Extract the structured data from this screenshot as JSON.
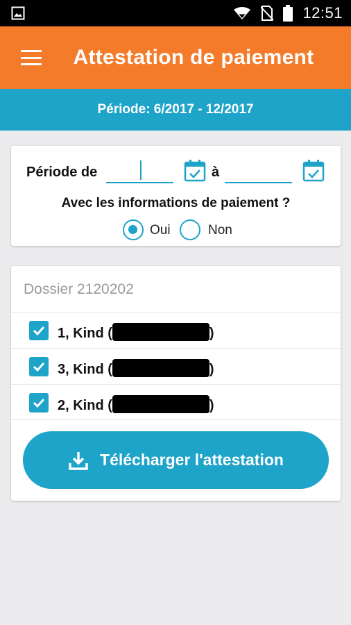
{
  "status_bar": {
    "time": "12:51",
    "icons": [
      "image-icon",
      "wifi-icon",
      "no-sim-icon",
      "battery-icon"
    ]
  },
  "app_bar": {
    "title": "Attestation de paiement",
    "menu_icon": "hamburger-menu-icon",
    "color": "#f47b2a"
  },
  "period_banner": {
    "text": "Période: 6/2017 - 12/2017",
    "color": "#1ea3c9"
  },
  "filter": {
    "period_from_label": "Période de",
    "period_from_value": "",
    "period_to_label": "à",
    "period_to_value": "",
    "calendar_icon": "calendar-check-icon",
    "question": "Avec les informations de paiement ?",
    "options": [
      {
        "label": "Oui",
        "selected": true
      },
      {
        "label": "Non",
        "selected": false
      }
    ]
  },
  "dossier": {
    "title": "Dossier 2120202",
    "children": [
      {
        "prefix": "1, Kind (",
        "suffix": ")",
        "checked": true
      },
      {
        "prefix": "3, Kind (",
        "suffix": ")",
        "checked": true
      },
      {
        "prefix": "2, Kind (",
        "suffix": ")",
        "checked": true
      }
    ],
    "download_button": {
      "label": "Télécharger l'attestation",
      "icon": "download-icon"
    }
  },
  "colors": {
    "accent": "#1ea3c9",
    "brand": "#f47b2a",
    "background": "#ececee"
  }
}
